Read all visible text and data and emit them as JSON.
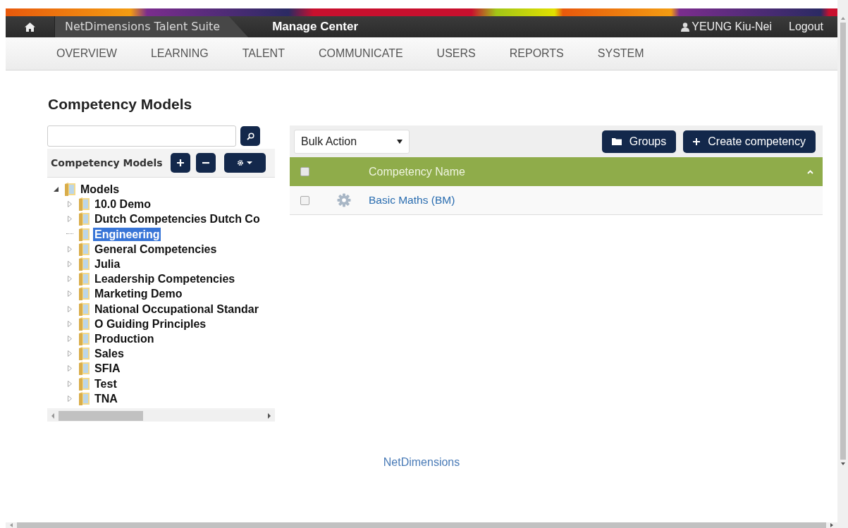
{
  "header": {
    "app_title": "NetDimensions Talent Suite",
    "center": "Manage Center",
    "user": "YEUNG Kiu-Nei",
    "logout": "Logout"
  },
  "nav": [
    "OVERVIEW",
    "LEARNING",
    "TALENT",
    "COMMUNICATE",
    "USERS",
    "REPORTS",
    "SYSTEM"
  ],
  "page_title": "Competency Models",
  "sidebar": {
    "title": "Competency Models",
    "tree": [
      {
        "label": "Models",
        "expandable": true,
        "expanded": true,
        "selected": false,
        "children": [
          {
            "label": "10.0 Demo",
            "expandable": true,
            "expanded": false,
            "selected": false
          },
          {
            "label": "Dutch Competencies Dutch Co",
            "expandable": true,
            "expanded": false,
            "selected": false
          },
          {
            "label": "Engineering",
            "expandable": false,
            "selected": true
          },
          {
            "label": "General Competencies",
            "expandable": true,
            "expanded": false,
            "selected": false
          },
          {
            "label": "Julia",
            "expandable": true,
            "expanded": false,
            "selected": false
          },
          {
            "label": "Leadership Competencies",
            "expandable": true,
            "expanded": false,
            "selected": false
          },
          {
            "label": "Marketing Demo",
            "expandable": true,
            "expanded": false,
            "selected": false
          },
          {
            "label": "National Occupational Standar",
            "expandable": true,
            "expanded": false,
            "selected": false
          },
          {
            "label": "O Guiding Principles",
            "expandable": true,
            "expanded": false,
            "selected": false
          },
          {
            "label": "Production",
            "expandable": true,
            "expanded": false,
            "selected": false
          },
          {
            "label": "Sales",
            "expandable": true,
            "expanded": false,
            "selected": false
          },
          {
            "label": "SFIA",
            "expandable": true,
            "expanded": false,
            "selected": false
          },
          {
            "label": "Test",
            "expandable": true,
            "expanded": false,
            "selected": false
          },
          {
            "label": "TNA",
            "expandable": true,
            "expanded": false,
            "selected": false
          }
        ]
      }
    ]
  },
  "toolbar": {
    "bulk_action": "Bulk Action",
    "groups_button": "Groups",
    "create_button": "Create competency"
  },
  "table": {
    "header_checked": false,
    "columns": [
      "Competency Name"
    ],
    "rows": [
      {
        "checked": false,
        "name": "Basic Maths (BM)"
      }
    ]
  },
  "footer": "NetDimensions"
}
